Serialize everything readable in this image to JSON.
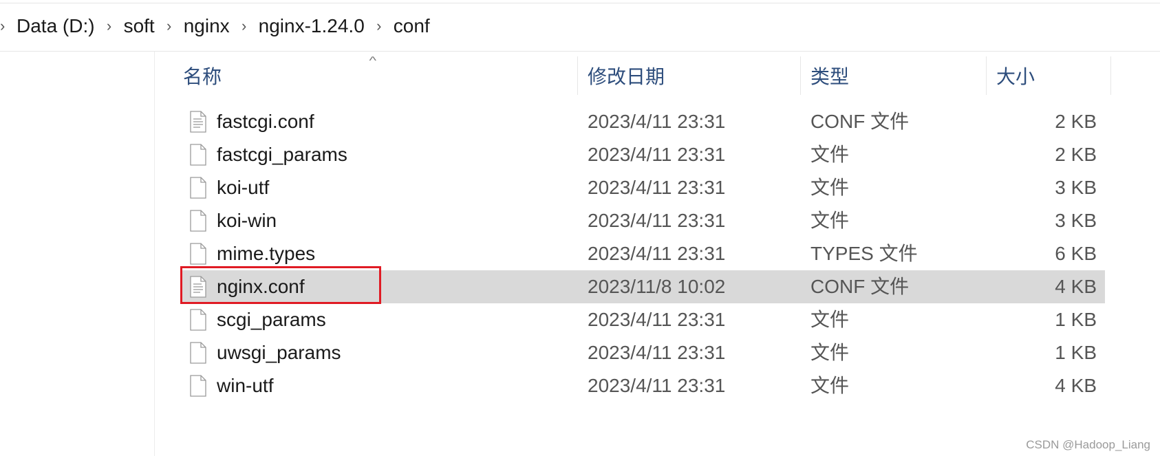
{
  "breadcrumb": {
    "items": [
      "Data (D:)",
      "soft",
      "nginx",
      "nginx-1.24.0",
      "conf"
    ],
    "separator": "›"
  },
  "columns": {
    "name": "名称",
    "date": "修改日期",
    "type": "类型",
    "size": "大小"
  },
  "files": [
    {
      "name": "fastcgi.conf",
      "date": "2023/4/11 23:31",
      "type": "CONF 文件",
      "size": "2 KB",
      "icon": "text-file-icon",
      "selected": false
    },
    {
      "name": "fastcgi_params",
      "date": "2023/4/11 23:31",
      "type": "文件",
      "size": "2 KB",
      "icon": "blank-file-icon",
      "selected": false
    },
    {
      "name": "koi-utf",
      "date": "2023/4/11 23:31",
      "type": "文件",
      "size": "3 KB",
      "icon": "blank-file-icon",
      "selected": false
    },
    {
      "name": "koi-win",
      "date": "2023/4/11 23:31",
      "type": "文件",
      "size": "3 KB",
      "icon": "blank-file-icon",
      "selected": false
    },
    {
      "name": "mime.types",
      "date": "2023/4/11 23:31",
      "type": "TYPES 文件",
      "size": "6 KB",
      "icon": "blank-file-icon",
      "selected": false
    },
    {
      "name": "nginx.conf",
      "date": "2023/11/8 10:02",
      "type": "CONF 文件",
      "size": "4 KB",
      "icon": "text-file-icon",
      "selected": true
    },
    {
      "name": "scgi_params",
      "date": "2023/4/11 23:31",
      "type": "文件",
      "size": "1 KB",
      "icon": "blank-file-icon",
      "selected": false
    },
    {
      "name": "uwsgi_params",
      "date": "2023/4/11 23:31",
      "type": "文件",
      "size": "1 KB",
      "icon": "blank-file-icon",
      "selected": false
    },
    {
      "name": "win-utf",
      "date": "2023/4/11 23:31",
      "type": "文件",
      "size": "4 KB",
      "icon": "blank-file-icon",
      "selected": false
    }
  ],
  "watermark": "CSDN @Hadoop_Liang",
  "colors": {
    "header_text": "#2d4d7c",
    "selected_row": "#d9d9d9",
    "highlight_border": "#e01b24"
  }
}
